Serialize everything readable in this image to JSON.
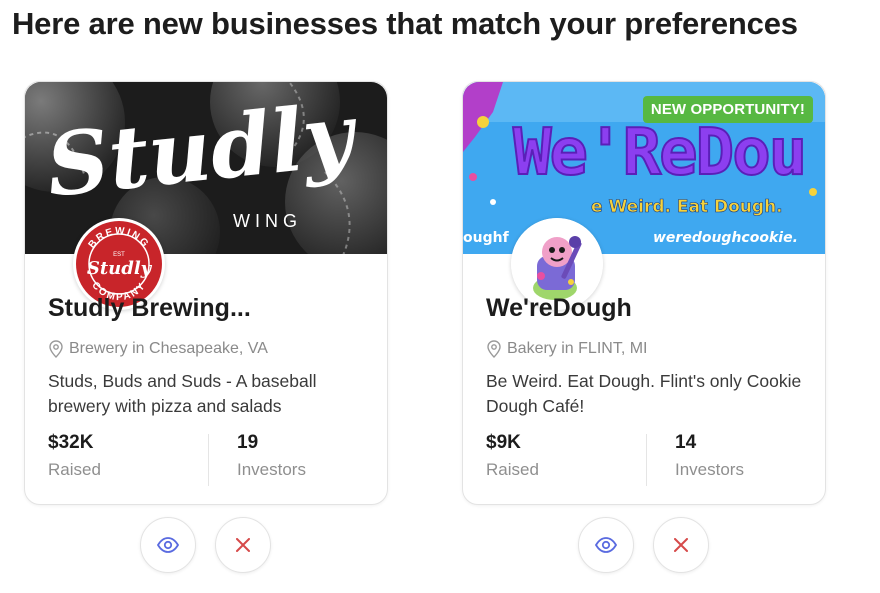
{
  "heading": "Here are new businesses that match your preferences",
  "colors": {
    "badge": "#57b842",
    "eye_icon": "#5a6be0",
    "close_icon": "#d64a4a",
    "muted_text": "#8a8a8a"
  },
  "icons": {
    "location": "map-pin-icon",
    "view": "eye-icon",
    "dismiss": "x-close-icon"
  },
  "cards": [
    {
      "name": "Studly Brewing...",
      "location": "Brewery in Chesapeake, VA",
      "description": "Studs, Buds and Suds - A baseball brewery with pizza and salads",
      "raised_value": "$32K",
      "raised_label": "Raised",
      "investors_value": "19",
      "investors_label": "Investors",
      "banner_text": "Studly",
      "banner_subtext": "WING",
      "logo_text": "Studly",
      "logo_ring_top": "BREWING",
      "logo_ring_bottom": "COMPANY",
      "logo_small": "EST"
    },
    {
      "name": "We'reDough",
      "location": "Bakery in FLINT, MI",
      "description": "Be Weird. Eat Dough. Flint's only Cookie Dough Café!",
      "raised_value": "$9K",
      "raised_label": "Raised",
      "investors_value": "14",
      "investors_label": "Investors",
      "badge": "NEW OPPORTUNITY!",
      "banner_text": "We'ReDou",
      "banner_tagline": "e Weird. Eat Dough.",
      "banner_left_text": "oughf",
      "banner_url": "weredoughcookie."
    }
  ]
}
